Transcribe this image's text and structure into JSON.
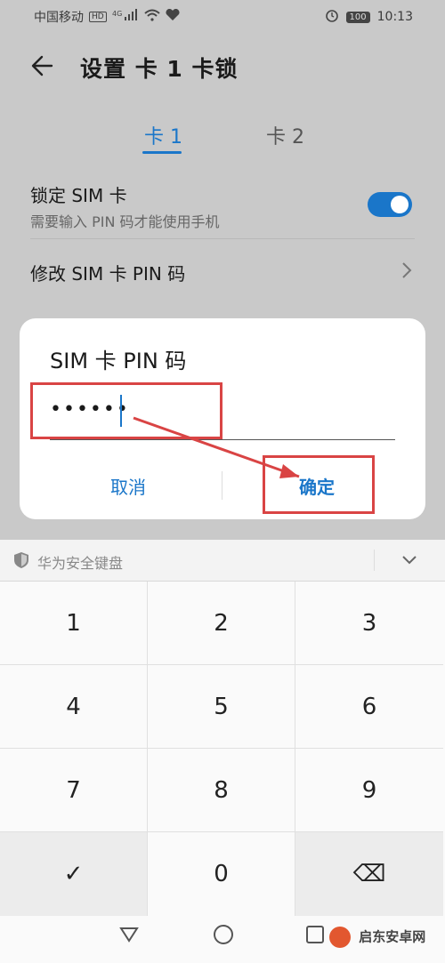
{
  "status_bar": {
    "carrier": "中国移动",
    "hd": "HD",
    "signal": "4G",
    "battery": "100",
    "time": "10:13"
  },
  "header": {
    "title": "设置 卡 1 卡锁"
  },
  "tabs": [
    {
      "label": "卡 1"
    },
    {
      "label": "卡 2"
    }
  ],
  "lock_row": {
    "label": "锁定 SIM 卡",
    "sub": "需要输入 PIN 码才能使用手机",
    "enabled": true
  },
  "change_pin_row": {
    "label": "修改 SIM 卡 PIN 码"
  },
  "dialog": {
    "title": "SIM 卡 PIN 码",
    "pin_value": "••••••",
    "cancel_label": "取消",
    "ok_label": "确定"
  },
  "keyboard": {
    "title": "华为安全键盘",
    "keys": [
      "1",
      "2",
      "3",
      "4",
      "5",
      "6",
      "7",
      "8",
      "9",
      "✓",
      "0",
      "⌫"
    ]
  },
  "watermark": "启东安卓网",
  "colors": {
    "accent": "#1a76c9",
    "annotation": "#d94444"
  }
}
